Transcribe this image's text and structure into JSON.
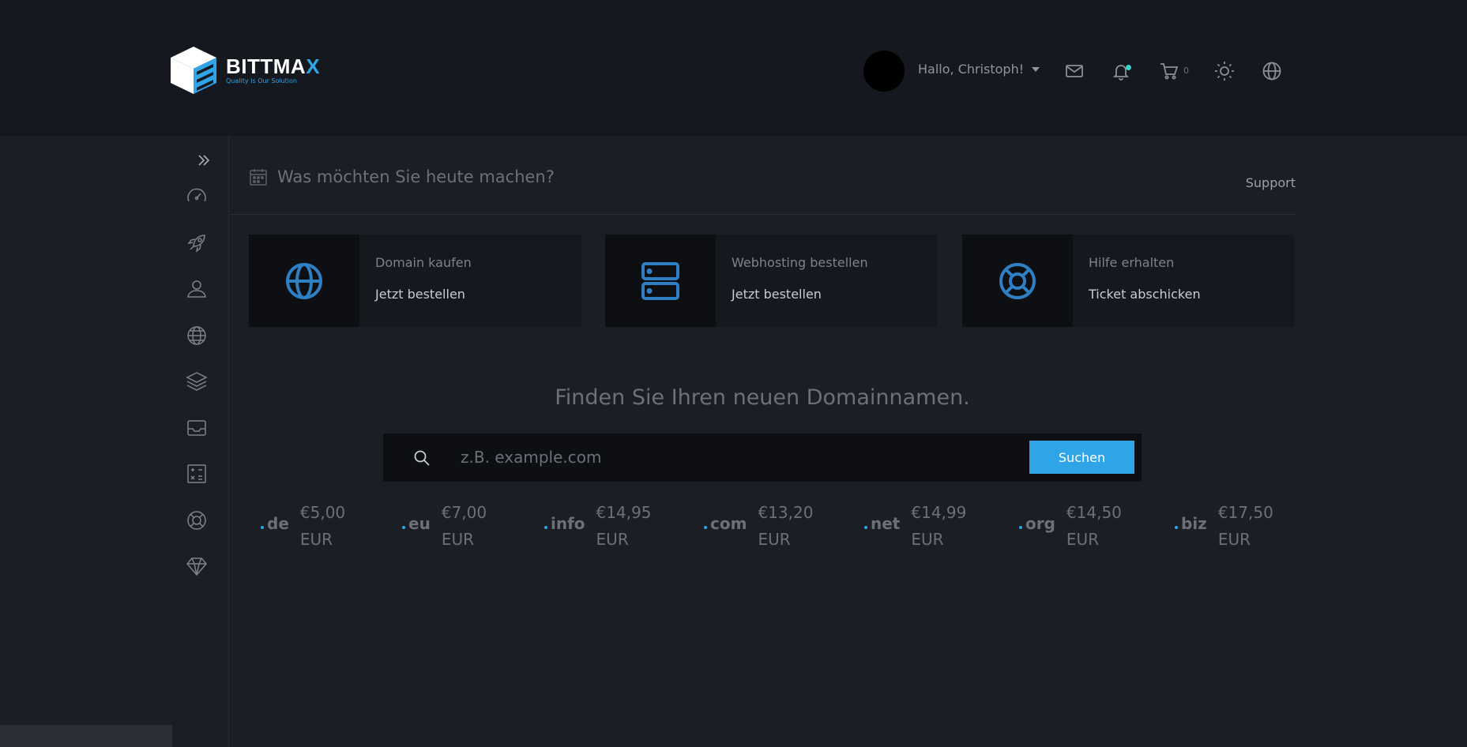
{
  "brand": {
    "name_main": "BITTMA",
    "name_accent": "X",
    "tagline": "Quality Is Our Solution"
  },
  "header": {
    "greeting": "Hallo, Christoph!",
    "cart_count": "0",
    "icons": [
      "mail-icon",
      "bell-icon",
      "cart-icon",
      "sun-icon",
      "globe-icon"
    ]
  },
  "sidebar": {
    "items": [
      "dashboard-icon",
      "rocket-icon",
      "user-icon",
      "globe-icon",
      "layers-icon",
      "inbox-icon",
      "calculator-icon",
      "lifebuoy-icon",
      "diamond-icon"
    ]
  },
  "main": {
    "headline": "Was möchten Sie heute machen?",
    "support": "Support",
    "cards": [
      {
        "title": "Domain kaufen",
        "action": "Jetzt bestellen",
        "icon": "globe-icon"
      },
      {
        "title": "Webhosting bestellen",
        "action": "Jetzt bestellen",
        "icon": "server-icon"
      },
      {
        "title": "Hilfe erhalten",
        "action": "Ticket abschicken",
        "icon": "lifebuoy-icon"
      }
    ],
    "search": {
      "title": "Finden Sie Ihren neuen Domainnamen.",
      "placeholder": "z.B. example.com",
      "button": "Suchen"
    },
    "tlds": [
      {
        "name": "de",
        "price": "€5,00",
        "currency": "EUR"
      },
      {
        "name": "eu",
        "price": "€7,00",
        "currency": "EUR"
      },
      {
        "name": "info",
        "price": "€14,95",
        "currency": "EUR"
      },
      {
        "name": "com",
        "price": "€13,20",
        "currency": "EUR"
      },
      {
        "name": "net",
        "price": "€14,99",
        "currency": "EUR"
      },
      {
        "name": "org",
        "price": "€14,50",
        "currency": "EUR"
      },
      {
        "name": "biz",
        "price": "€17,50",
        "currency": "EUR"
      }
    ]
  },
  "colors": {
    "accent": "#2fa4e7",
    "background": "#1b1e25",
    "topbar": "#15181e",
    "notification": "#35d5c7"
  }
}
